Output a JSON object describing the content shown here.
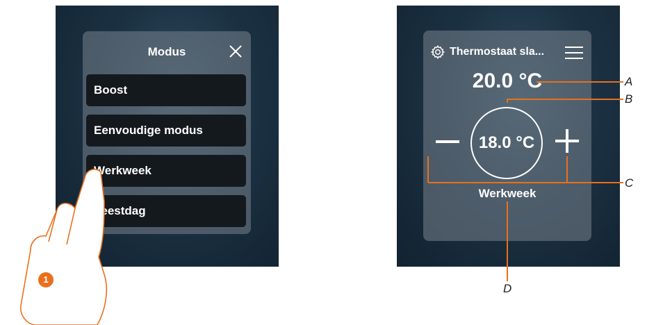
{
  "left_screen": {
    "panel_title": "Modus",
    "close_icon": "close-icon",
    "options": [
      {
        "label": "Boost"
      },
      {
        "label": "Eenvoudige modus"
      },
      {
        "label": "Werkweek"
      },
      {
        "label": "Feestdag"
      }
    ]
  },
  "right_screen": {
    "settings_icon": "gear-icon",
    "thermostat_name": "Thermostaat sla...",
    "menu_icon": "menu-icon",
    "measured_temperature": "20.0 °C",
    "setpoint_temperature": "18.0 °C",
    "mode": "Werkweek"
  },
  "callouts": {
    "a": "A",
    "b": "B",
    "c": "C",
    "d": "D"
  },
  "step": {
    "number": "1"
  },
  "colors": {
    "accent": "#e8711d",
    "screen_dark": "#1b3142",
    "button_bg": "#14191e"
  }
}
